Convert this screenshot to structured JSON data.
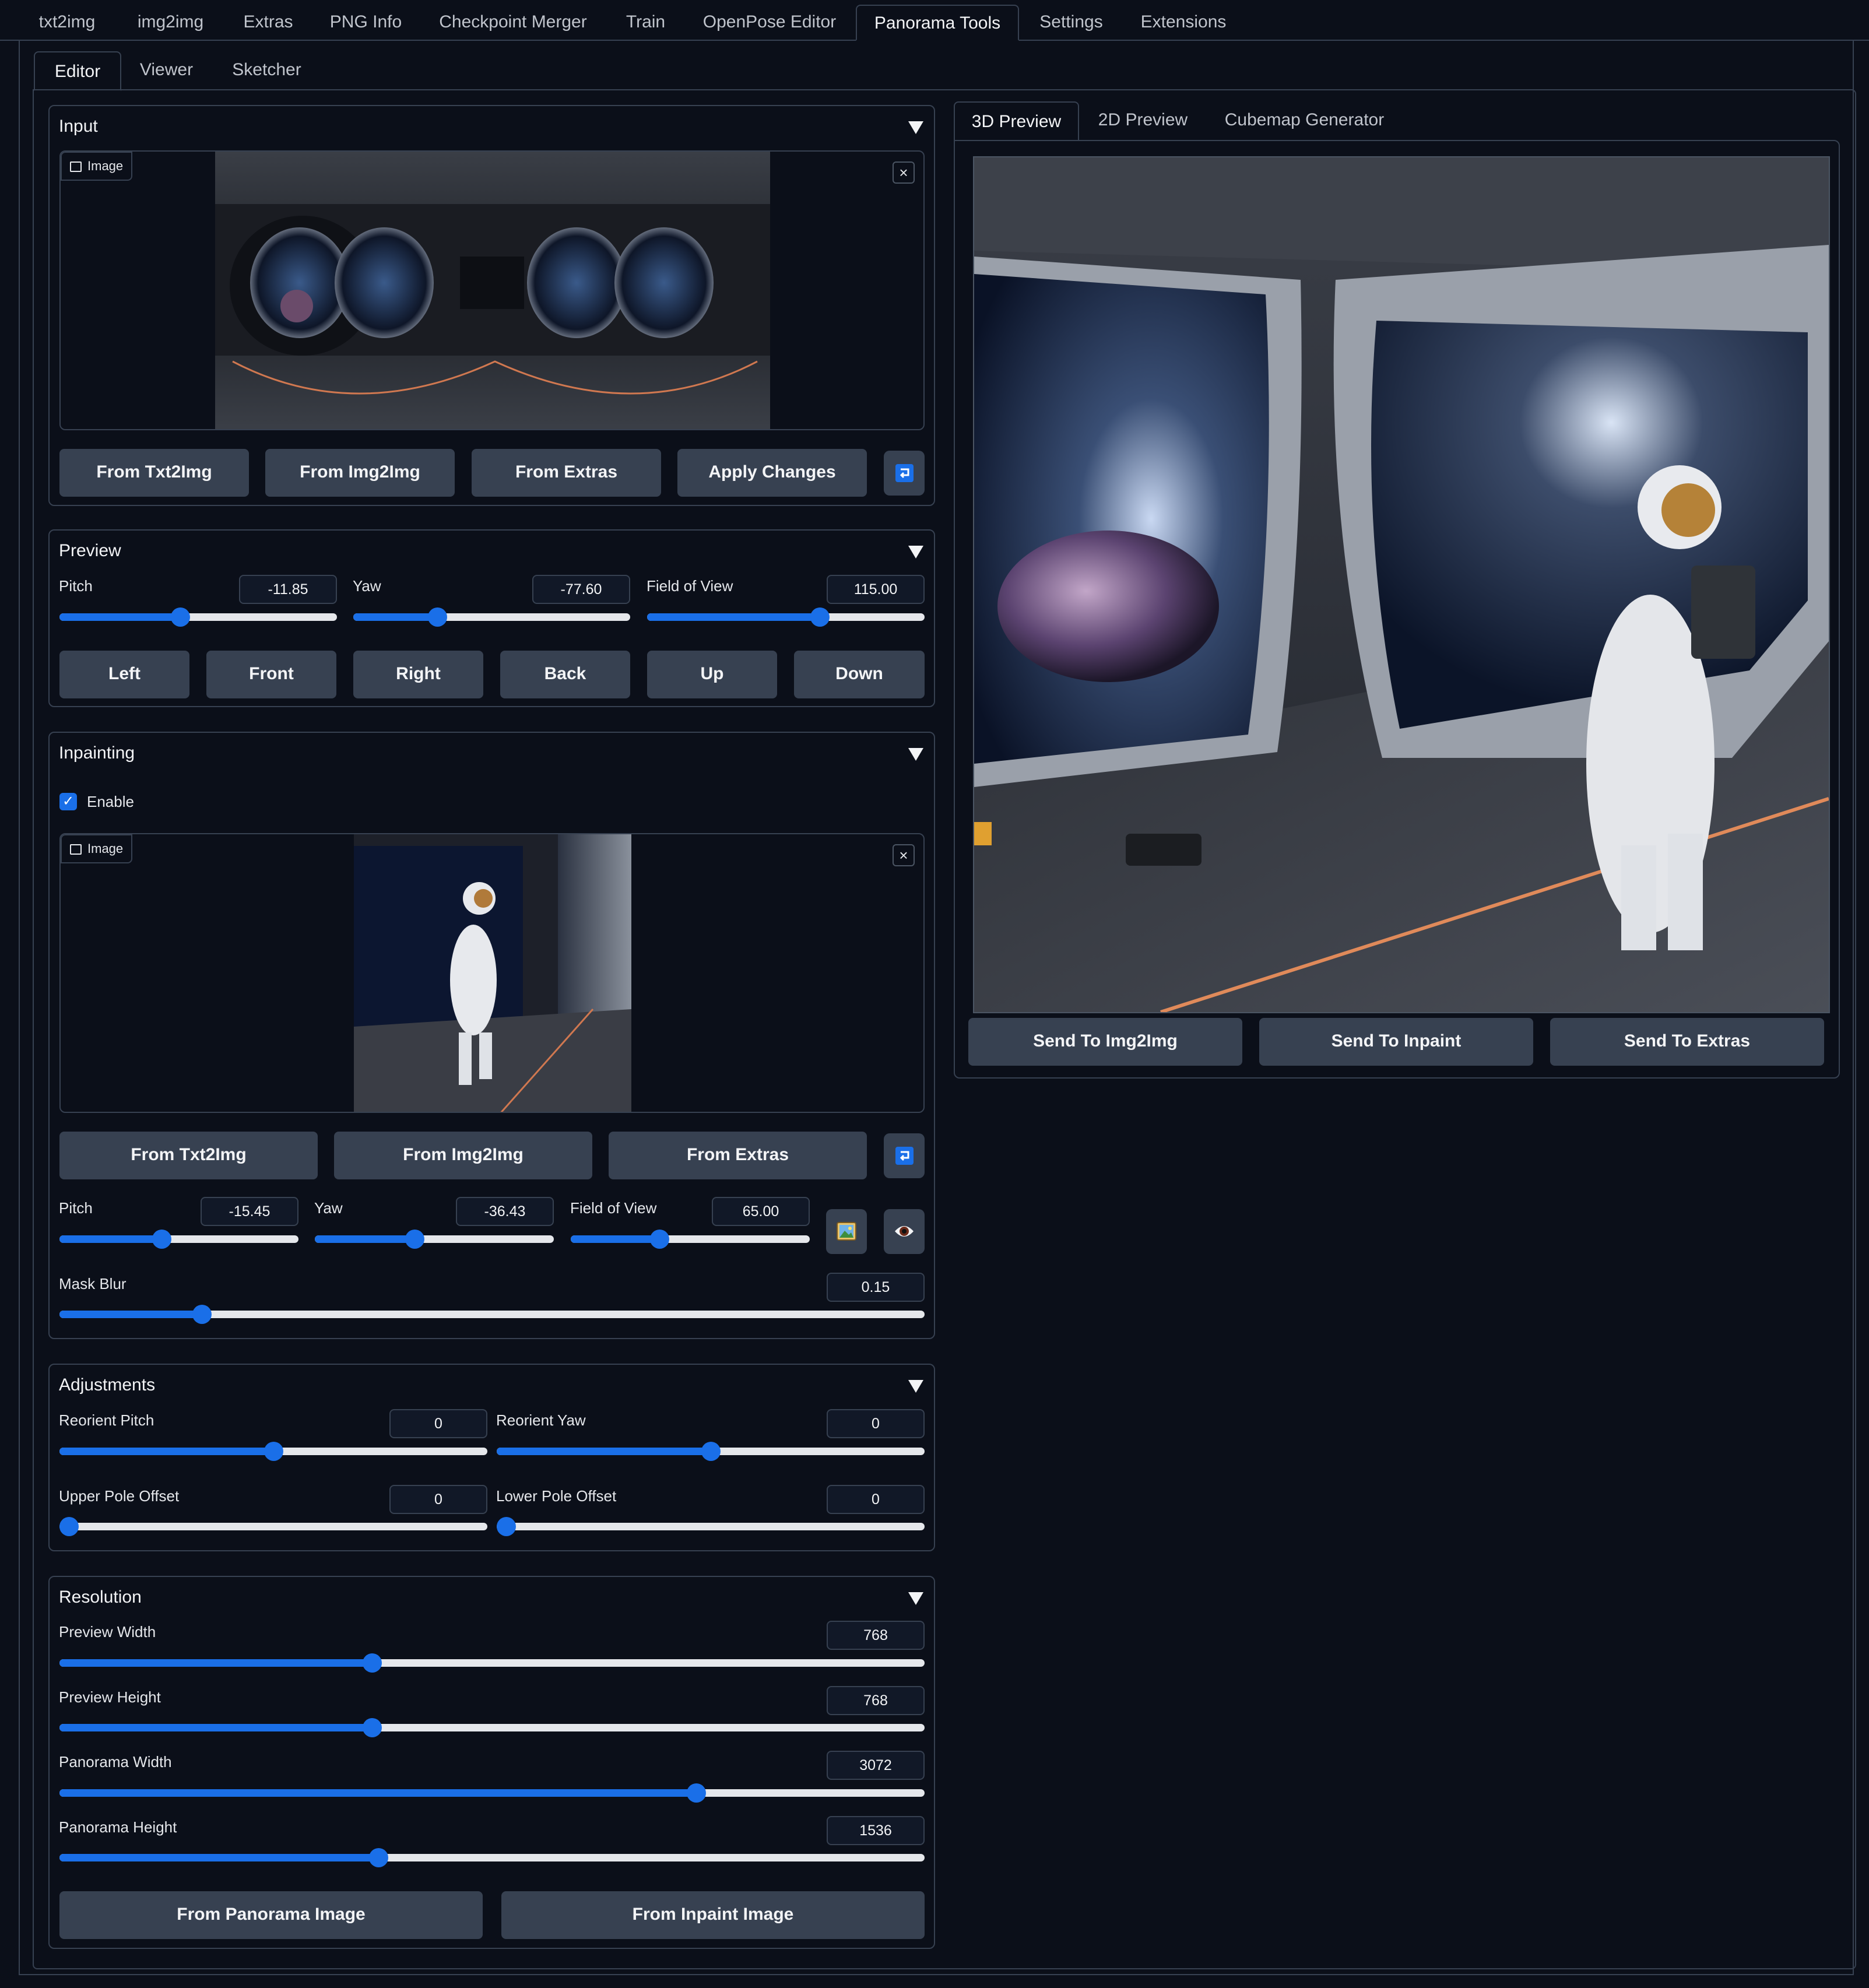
{
  "top_tabs": [
    {
      "label": "txt2img"
    },
    {
      "label": "img2img"
    },
    {
      "label": "Extras"
    },
    {
      "label": "PNG Info"
    },
    {
      "label": "Checkpoint Merger"
    },
    {
      "label": "Train"
    },
    {
      "label": "OpenPose Editor"
    },
    {
      "label": "Panorama Tools",
      "active": true
    },
    {
      "label": "Settings"
    },
    {
      "label": "Extensions"
    }
  ],
  "sub_tabs": [
    {
      "label": "Editor",
      "active": true
    },
    {
      "label": "Viewer"
    },
    {
      "label": "Sketcher"
    }
  ],
  "input": {
    "title": "Input",
    "image_label": "Image",
    "buttons": [
      "From Txt2Img",
      "From Img2Img",
      "From Extras",
      "Apply Changes"
    ]
  },
  "preview": {
    "title": "Preview",
    "pitch": {
      "label": "Pitch",
      "value": "-11.85",
      "fraction": 0.43
    },
    "yaw": {
      "label": "Yaw",
      "value": "-77.60",
      "fraction": 0.29
    },
    "fov": {
      "label": "Field of View",
      "value": "115.00",
      "fraction": 0.63
    },
    "buttons": [
      "Left",
      "Front",
      "Right",
      "Back",
      "Up",
      "Down"
    ]
  },
  "inpainting": {
    "title": "Inpainting",
    "enable_label": "Enable",
    "enabled": true,
    "image_label": "Image",
    "buttons": [
      "From Txt2Img",
      "From Img2Img",
      "From Extras"
    ],
    "pitch": {
      "label": "Pitch",
      "value": "-15.45",
      "fraction": 0.42
    },
    "yaw": {
      "label": "Yaw",
      "value": "-36.43",
      "fraction": 0.41
    },
    "fov": {
      "label": "Field of View",
      "value": "65.00",
      "fraction": 0.36
    },
    "mask_blur": {
      "label": "Mask Blur",
      "value": "0.15",
      "fraction": 0.157
    }
  },
  "adjustments": {
    "title": "Adjustments",
    "reorient_pitch": {
      "label": "Reorient Pitch",
      "value": "0",
      "fraction": 0.5
    },
    "reorient_yaw": {
      "label": "Reorient Yaw",
      "value": "0",
      "fraction": 0.5
    },
    "upper_pole": {
      "label": "Upper Pole Offset",
      "value": "0",
      "fraction": 0.0
    },
    "lower_pole": {
      "label": "Lower Pole Offset",
      "value": "0",
      "fraction": 0.0
    }
  },
  "resolution": {
    "title": "Resolution",
    "preview_width": {
      "label": "Preview Width",
      "value": "768",
      "fraction": 0.358
    },
    "preview_height": {
      "label": "Preview Height",
      "value": "768",
      "fraction": 0.358
    },
    "panorama_width": {
      "label": "Panorama Width",
      "value": "3072",
      "fraction": 0.741
    },
    "panorama_height": {
      "label": "Panorama Height",
      "value": "1536",
      "fraction": 0.366
    },
    "buttons": [
      "From Panorama Image",
      "From Inpaint Image"
    ]
  },
  "right": {
    "tabs": [
      {
        "label": "3D Preview",
        "active": true
      },
      {
        "label": "2D Preview"
      },
      {
        "label": "Cubemap Generator"
      }
    ],
    "buttons": [
      "Send To Img2Img",
      "Send To Inpaint",
      "Send To Extras"
    ]
  },
  "colors": {
    "accent": "#1a6fe8",
    "background": "#0b0f19",
    "border": "#374151",
    "button": "#374151"
  },
  "icons": {
    "collapse": "triangle-down-icon",
    "image": "image-icon",
    "close": "close-icon",
    "swap": "swap-icon",
    "picture": "picture-icon",
    "eye": "eye-icon",
    "check": "checkmark-icon"
  }
}
